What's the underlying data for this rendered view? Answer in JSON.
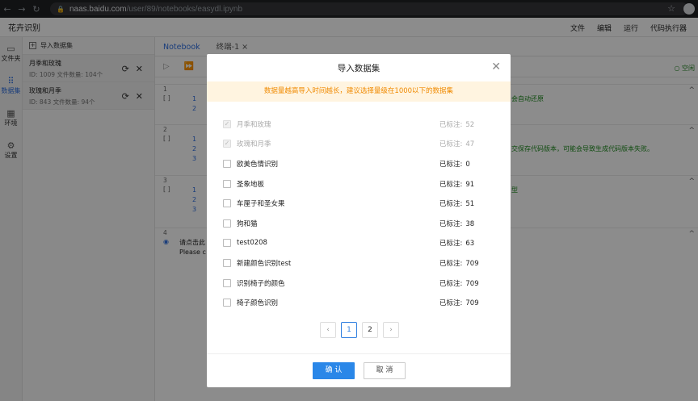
{
  "browser": {
    "url_domain": "naas.baidu.com",
    "url_path": "/user/89/notebooks/easydl.ipynb"
  },
  "app": {
    "title": "花卉识别",
    "menu": [
      "文件",
      "编辑",
      "运行",
      "代码执行器"
    ]
  },
  "sidebar": {
    "items": [
      {
        "label": "文件夹",
        "icon": "folder-icon"
      },
      {
        "label": "数据集",
        "icon": "grid-icon"
      },
      {
        "label": "环境",
        "icon": "blocks-icon"
      },
      {
        "label": "设置",
        "icon": "gear-icon"
      }
    ]
  },
  "dataset_panel": {
    "header": "导入数据集",
    "items": [
      {
        "name": "月季和玫瑰",
        "meta": "ID: 1009 文件数量: 104个"
      },
      {
        "name": "玫瑰和月季",
        "meta": "ID: 843 文件数量: 94个"
      }
    ]
  },
  "editor": {
    "tabs": [
      "Notebook",
      "终端-1 ×"
    ],
    "kernel_status": "空闲",
    "cells": [
      {
        "num": "1",
        "bracket": "[ ]",
        "lines": [
          "1",
          "2"
        ],
        "tail": "会自动还原"
      },
      {
        "num": "2",
        "bracket": "[ ]",
        "lines": [
          "1",
          "2",
          "3"
        ],
        "tail": "交保存代码版本，可能会导致生成代码版本失败。"
      },
      {
        "num": "3",
        "bracket": "[ ]",
        "lines": [
          "1",
          "2",
          "3"
        ],
        "tail": "型"
      },
      {
        "num": "4",
        "text1": "请点击此",
        "text2": "Please c"
      }
    ]
  },
  "modal": {
    "title": "导入数据集",
    "notice": "数据量越高导入时间越长，建议选择量级在1000以下的数据集",
    "stat_label": "已标注:",
    "rows": [
      {
        "name": "月季和玫瑰",
        "count": "52",
        "disabled": true
      },
      {
        "name": "玫瑰和月季",
        "count": "47",
        "disabled": true
      },
      {
        "name": "欧美色情识别",
        "count": "0",
        "disabled": false
      },
      {
        "name": "圣象地板",
        "count": "91",
        "disabled": false
      },
      {
        "name": "车厘子和圣女果",
        "count": "51",
        "disabled": false
      },
      {
        "name": "狗和猫",
        "count": "38",
        "disabled": false
      },
      {
        "name": "test0208",
        "count": "63",
        "disabled": false
      },
      {
        "name": "新建颜色识别test",
        "count": "709",
        "disabled": false
      },
      {
        "name": "识别椅子的颜色",
        "count": "709",
        "disabled": false
      },
      {
        "name": "椅子颜色识别",
        "count": "709",
        "disabled": false
      }
    ],
    "pages": [
      "1",
      "2"
    ],
    "current_page": "1",
    "confirm_label": "确 认",
    "cancel_label": "取 消"
  }
}
